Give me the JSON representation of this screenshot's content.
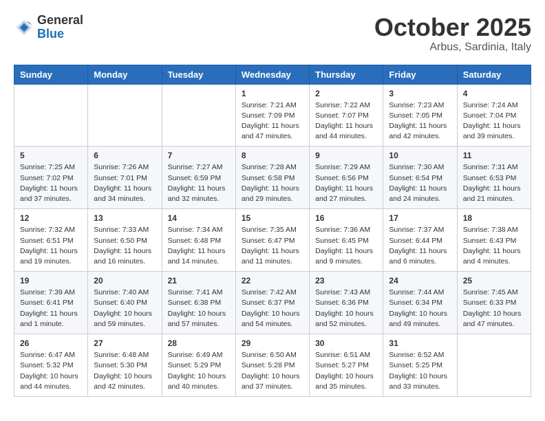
{
  "header": {
    "logo_general": "General",
    "logo_blue": "Blue",
    "month": "October 2025",
    "location": "Arbus, Sardinia, Italy"
  },
  "weekdays": [
    "Sunday",
    "Monday",
    "Tuesday",
    "Wednesday",
    "Thursday",
    "Friday",
    "Saturday"
  ],
  "weeks": [
    [
      {
        "day": "",
        "info": ""
      },
      {
        "day": "",
        "info": ""
      },
      {
        "day": "",
        "info": ""
      },
      {
        "day": "1",
        "info": "Sunrise: 7:21 AM\nSunset: 7:09 PM\nDaylight: 11 hours and 47 minutes."
      },
      {
        "day": "2",
        "info": "Sunrise: 7:22 AM\nSunset: 7:07 PM\nDaylight: 11 hours and 44 minutes."
      },
      {
        "day": "3",
        "info": "Sunrise: 7:23 AM\nSunset: 7:05 PM\nDaylight: 11 hours and 42 minutes."
      },
      {
        "day": "4",
        "info": "Sunrise: 7:24 AM\nSunset: 7:04 PM\nDaylight: 11 hours and 39 minutes."
      }
    ],
    [
      {
        "day": "5",
        "info": "Sunrise: 7:25 AM\nSunset: 7:02 PM\nDaylight: 11 hours and 37 minutes."
      },
      {
        "day": "6",
        "info": "Sunrise: 7:26 AM\nSunset: 7:01 PM\nDaylight: 11 hours and 34 minutes."
      },
      {
        "day": "7",
        "info": "Sunrise: 7:27 AM\nSunset: 6:59 PM\nDaylight: 11 hours and 32 minutes."
      },
      {
        "day": "8",
        "info": "Sunrise: 7:28 AM\nSunset: 6:58 PM\nDaylight: 11 hours and 29 minutes."
      },
      {
        "day": "9",
        "info": "Sunrise: 7:29 AM\nSunset: 6:56 PM\nDaylight: 11 hours and 27 minutes."
      },
      {
        "day": "10",
        "info": "Sunrise: 7:30 AM\nSunset: 6:54 PM\nDaylight: 11 hours and 24 minutes."
      },
      {
        "day": "11",
        "info": "Sunrise: 7:31 AM\nSunset: 6:53 PM\nDaylight: 11 hours and 21 minutes."
      }
    ],
    [
      {
        "day": "12",
        "info": "Sunrise: 7:32 AM\nSunset: 6:51 PM\nDaylight: 11 hours and 19 minutes."
      },
      {
        "day": "13",
        "info": "Sunrise: 7:33 AM\nSunset: 6:50 PM\nDaylight: 11 hours and 16 minutes."
      },
      {
        "day": "14",
        "info": "Sunrise: 7:34 AM\nSunset: 6:48 PM\nDaylight: 11 hours and 14 minutes."
      },
      {
        "day": "15",
        "info": "Sunrise: 7:35 AM\nSunset: 6:47 PM\nDaylight: 11 hours and 11 minutes."
      },
      {
        "day": "16",
        "info": "Sunrise: 7:36 AM\nSunset: 6:45 PM\nDaylight: 11 hours and 9 minutes."
      },
      {
        "day": "17",
        "info": "Sunrise: 7:37 AM\nSunset: 6:44 PM\nDaylight: 11 hours and 6 minutes."
      },
      {
        "day": "18",
        "info": "Sunrise: 7:38 AM\nSunset: 6:43 PM\nDaylight: 11 hours and 4 minutes."
      }
    ],
    [
      {
        "day": "19",
        "info": "Sunrise: 7:39 AM\nSunset: 6:41 PM\nDaylight: 11 hours and 1 minute."
      },
      {
        "day": "20",
        "info": "Sunrise: 7:40 AM\nSunset: 6:40 PM\nDaylight: 10 hours and 59 minutes."
      },
      {
        "day": "21",
        "info": "Sunrise: 7:41 AM\nSunset: 6:38 PM\nDaylight: 10 hours and 57 minutes."
      },
      {
        "day": "22",
        "info": "Sunrise: 7:42 AM\nSunset: 6:37 PM\nDaylight: 10 hours and 54 minutes."
      },
      {
        "day": "23",
        "info": "Sunrise: 7:43 AM\nSunset: 6:36 PM\nDaylight: 10 hours and 52 minutes."
      },
      {
        "day": "24",
        "info": "Sunrise: 7:44 AM\nSunset: 6:34 PM\nDaylight: 10 hours and 49 minutes."
      },
      {
        "day": "25",
        "info": "Sunrise: 7:45 AM\nSunset: 6:33 PM\nDaylight: 10 hours and 47 minutes."
      }
    ],
    [
      {
        "day": "26",
        "info": "Sunrise: 6:47 AM\nSunset: 5:32 PM\nDaylight: 10 hours and 44 minutes."
      },
      {
        "day": "27",
        "info": "Sunrise: 6:48 AM\nSunset: 5:30 PM\nDaylight: 10 hours and 42 minutes."
      },
      {
        "day": "28",
        "info": "Sunrise: 6:49 AM\nSunset: 5:29 PM\nDaylight: 10 hours and 40 minutes."
      },
      {
        "day": "29",
        "info": "Sunrise: 6:50 AM\nSunset: 5:28 PM\nDaylight: 10 hours and 37 minutes."
      },
      {
        "day": "30",
        "info": "Sunrise: 6:51 AM\nSunset: 5:27 PM\nDaylight: 10 hours and 35 minutes."
      },
      {
        "day": "31",
        "info": "Sunrise: 6:52 AM\nSunset: 5:25 PM\nDaylight: 10 hours and 33 minutes."
      },
      {
        "day": "",
        "info": ""
      }
    ]
  ]
}
